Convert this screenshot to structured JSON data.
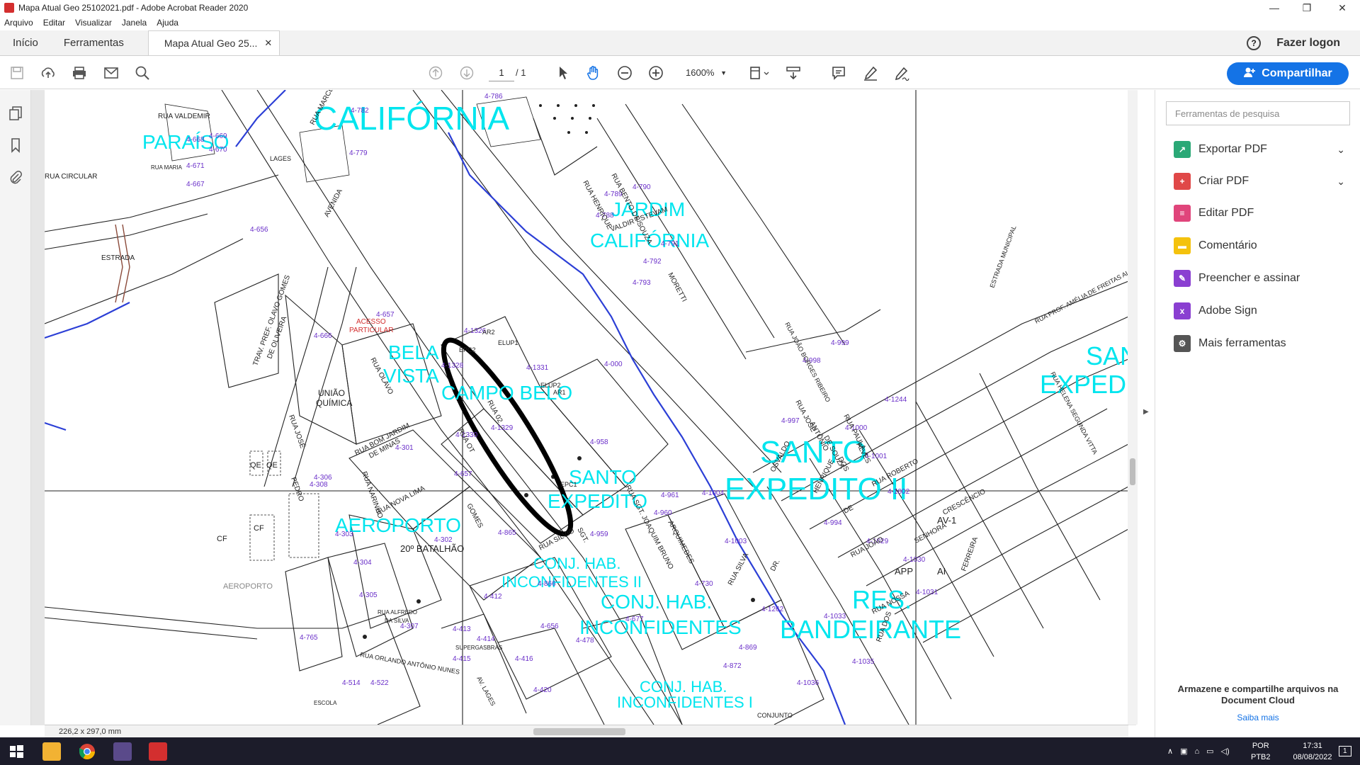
{
  "window": {
    "title": "Mapa Atual Geo 25102021.pdf - Adobe Acrobat Reader 2020",
    "minimize": "—",
    "maximize": "❐",
    "close": "✕"
  },
  "menu": [
    "Arquivo",
    "Editar",
    "Visualizar",
    "Janela",
    "Ajuda"
  ],
  "tabs": {
    "home": "Início",
    "tools": "Ferramentas",
    "document": "Mapa Atual Geo 25...",
    "close": "✕"
  },
  "header": {
    "help": "?",
    "logon": "Fazer logon"
  },
  "toolbar": {
    "page_current": "1",
    "page_total": "/  1",
    "zoom": "1600%",
    "share": "Compartilhar"
  },
  "status": {
    "dimensions": "226,2 x 297,0 mm"
  },
  "right_panel": {
    "search_placeholder": "Ferramentas de pesquisa",
    "tools": [
      {
        "label": "Exportar PDF",
        "icon": "export-pdf-icon",
        "color": "#2aa876"
      },
      {
        "label": "Criar PDF",
        "icon": "create-pdf-icon",
        "color": "#e04848"
      },
      {
        "label": "Editar PDF",
        "icon": "edit-pdf-icon",
        "color": "#e0457b"
      },
      {
        "label": "Comentário",
        "icon": "comment-icon",
        "color": "#f4c20d"
      },
      {
        "label": "Preencher e assinar",
        "icon": "fill-sign-icon",
        "color": "#8a3fd1"
      },
      {
        "label": "Adobe Sign",
        "icon": "adobe-sign-icon",
        "color": "#8a3fd1"
      },
      {
        "label": "Mais ferramentas",
        "icon": "more-tools-icon",
        "color": "#555555"
      }
    ],
    "cloud_text": "Armazene e compartilhe arquivos na Document Cloud",
    "cloud_link": "Saiba mais"
  },
  "taskbar": {
    "lang": "POR",
    "layout": "PTB2",
    "time": "17:31",
    "date": "08/08/2022",
    "notif": "1"
  },
  "map": {
    "neighborhoods": [
      "CALIFÓRNIA",
      "PARAÍSO",
      "JARDIM",
      "CALIFÓRNIA",
      "BELA",
      "VISTA",
      "CAMPO BELO",
      "SANTO",
      "EXPEDITO",
      "SANTO",
      "EXPEDITO II",
      "AEROPORTO",
      "CONJ. HAB.",
      "INCONFIDENTES II",
      "CONJ. HAB.",
      "INCONFIDENTES",
      "CONJ. HAB.",
      "INCONFIDENTES I",
      "RES.",
      "BANDEIRANTE",
      "SAN",
      "EXPED"
    ],
    "lots": [
      "4-782",
      "4-786",
      "4-669",
      "4-668",
      "4-670",
      "4-671",
      "4-667",
      "4-779",
      "4-790",
      "4-789",
      "4-788",
      "4-791",
      "4-792",
      "4-793",
      "4-656",
      "4-657",
      "4-666",
      "4-1326",
      "4-1328",
      "4-1331",
      "4-1329",
      "4-1330",
      "4-657",
      "4-000",
      "4-958",
      "4-960",
      "4-961",
      "4-959",
      "4-301",
      "4-302",
      "4-303",
      "4-304",
      "4-305",
      "4-306",
      "4-308",
      "4-307",
      "4-412",
      "4-413",
      "4-414",
      "4-415",
      "4-416",
      "4-420",
      "4-765",
      "4-514",
      "4-522",
      "4-1004",
      "4-1003",
      "4-999",
      "4-998",
      "4-997",
      "4-1000",
      "4-1001",
      "4-1002",
      "4-1244",
      "4-994",
      "4-1029",
      "4-1030",
      "4-1031",
      "4-1033",
      "4-1035",
      "4-1036",
      "4-1262",
      "4-872",
      "4-869",
      "4-730",
      "4-677",
      "4-478",
      "4-866",
      "4-865",
      "4-656"
    ],
    "labels": [
      "UNIÃO",
      "QUÍMICA",
      "ACESSO",
      "PARTICULAR",
      "20º BATALHÃO",
      "CF",
      "CF",
      "QE",
      "QE",
      "AV-1",
      "APP",
      "AI",
      "AR2",
      "AR1",
      "EPC1",
      "EPC2",
      "ELUP1",
      "ELUP2",
      "AEROPORTO",
      "SUPERGASBRAS",
      "ESCOLA",
      "CONJUNTO",
      "LAGES",
      "RUA VALDEMIR",
      "RUA MARIA",
      "RUA CIRCULAR",
      "ESTRADA",
      "TRAV. PREF. OLAVO GOMES",
      "DE OLIVEIRA",
      "RUA JOSÉ",
      "PEDRO",
      "RUA NARINHO",
      "RUA NOVA LIMA",
      "RUA SILVIO",
      "SGT.",
      "RUA SGT. JOAQUIM BRUNO",
      "ARQUIMEDES",
      "RUA JOSÉ",
      "ANTÔNIO",
      "DE SOUZA",
      "RUA PAULA",
      "ALVES",
      "DOS",
      "RUA ROBERTO",
      "DE",
      "RUA JOÃO",
      "SENHORA",
      "RUA NOSSA",
      "FERREIRA",
      "CRESCÊNCIO",
      "RUA DOS",
      "RUA OT",
      "RUA 02",
      "RUA OLAVO",
      "GOMES",
      "RUA BOM JARDIM",
      "DE MINAS",
      "AVENIDA",
      "RUA ALFREDO",
      "DA SILVA",
      "RUA ORLANDO ANTÔNIO NUNES",
      "AV. LAGES",
      "RUA MARCELO",
      "RUA BENTO DE SOUZA",
      "VALDIR ESTEVAM",
      "RUA HENRIQUE",
      "MORETTI",
      "RUA JOÃO BORGES RIBEIRO",
      "ESTRADA MUNICIPAL",
      "RUA PROF. AMÉLIA DE FREITAS ALVES",
      "RUA HELENA SEGUNDA VITTA",
      "OSVALDO",
      "HENRIQUE",
      "RUA SILVA",
      "DR."
    ]
  }
}
